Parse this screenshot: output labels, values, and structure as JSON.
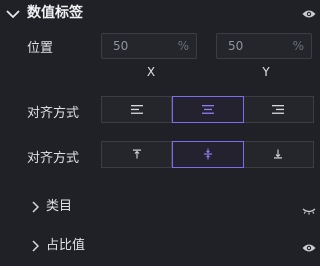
{
  "section": {
    "title": "数值标签",
    "expand_icon": "chevron-down-icon",
    "visibility_icon": "eye-icon"
  },
  "position": {
    "label": "位置",
    "x": {
      "value": "50",
      "unit": "%",
      "axis": "X"
    },
    "y": {
      "value": "50",
      "unit": "%",
      "axis": "Y"
    }
  },
  "align_horizontal": {
    "label": "对齐方式",
    "options": [
      "align-left-icon",
      "align-center-icon",
      "align-right-icon"
    ],
    "selected": "align-center-icon"
  },
  "align_vertical": {
    "label": "对齐方式",
    "options": [
      "align-top-icon",
      "align-middle-icon",
      "align-bottom-icon"
    ],
    "selected": "align-middle-icon"
  },
  "groups": [
    {
      "label": "类目",
      "visibility_icon": "eye-closed-icon"
    },
    {
      "label": "占比值",
      "visibility_icon": "eye-icon"
    }
  ],
  "colors": {
    "background": "#1f2126",
    "accent": "#7b6cf0",
    "border": "#3a3d44"
  }
}
